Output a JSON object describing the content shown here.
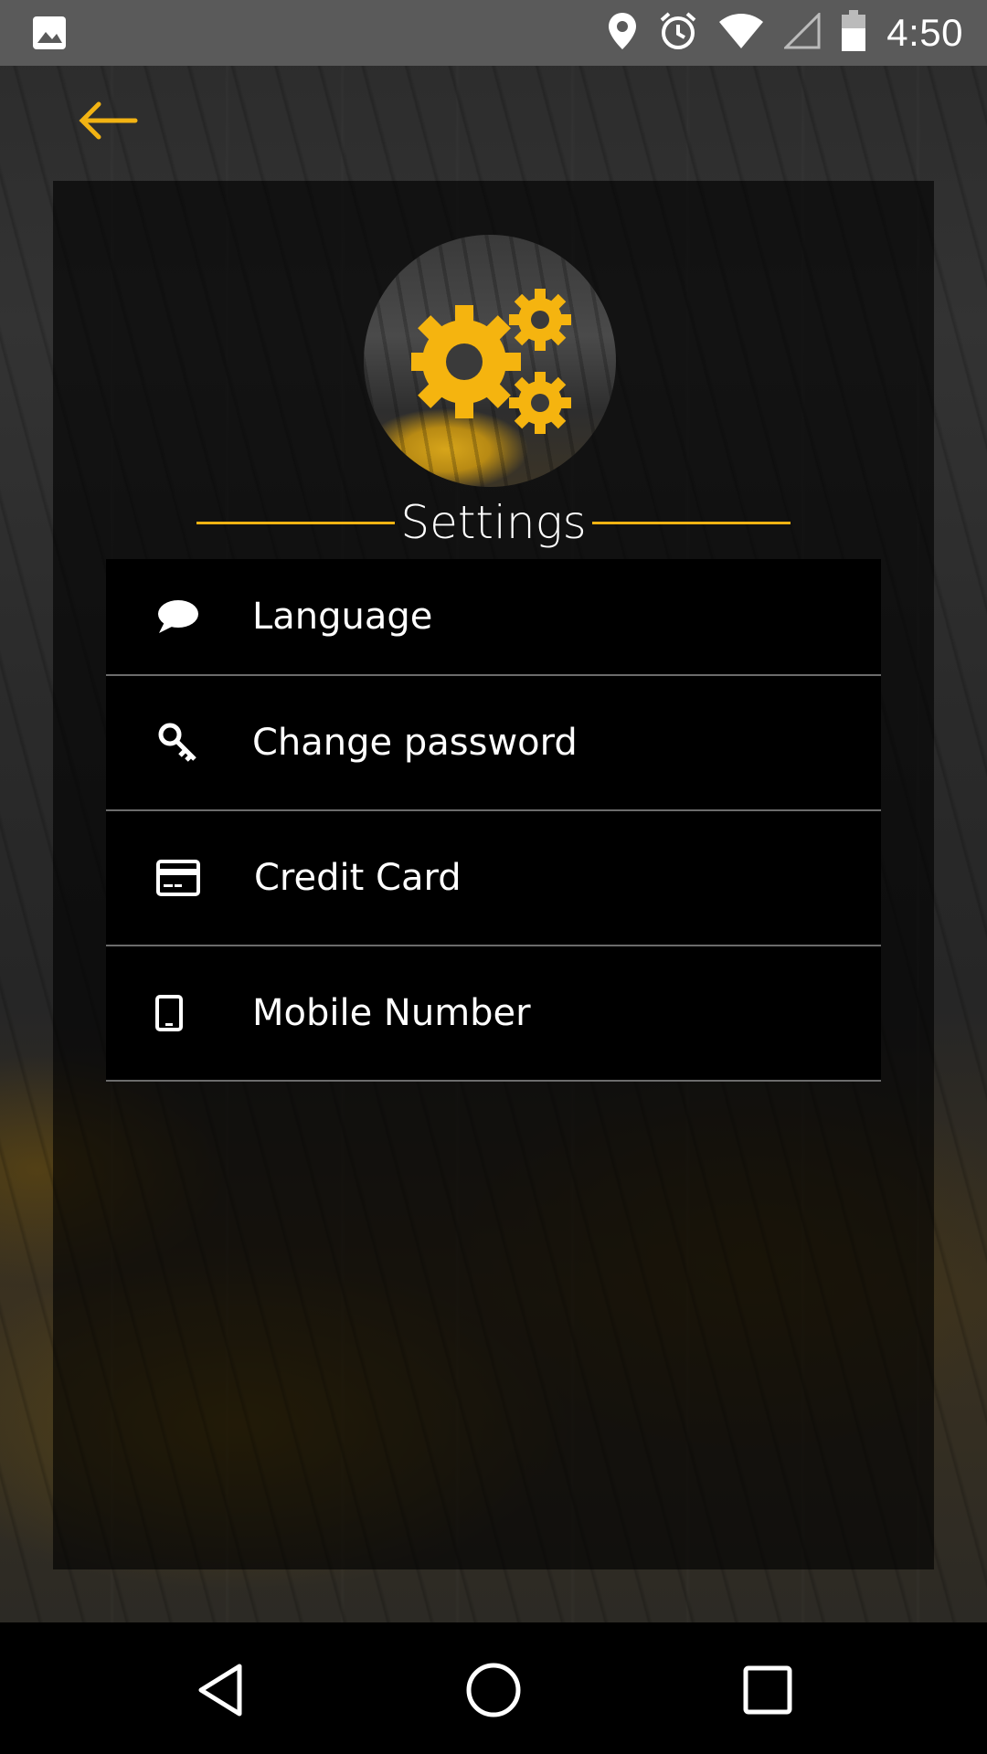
{
  "status_bar": {
    "time": "4:50",
    "icons": [
      "image-icon",
      "location-icon",
      "alarm-icon",
      "wifi-icon",
      "signal-icon",
      "battery-icon"
    ]
  },
  "header": {
    "back_icon": "arrow-left-icon"
  },
  "settings": {
    "title": "Settings",
    "items": [
      {
        "label": "Language",
        "icon": "chat-bubble-icon"
      },
      {
        "label": "Change password",
        "icon": "key-icon"
      },
      {
        "label": "Credit Card",
        "icon": "credit-card-icon"
      },
      {
        "label": "Mobile Number",
        "icon": "phone-icon"
      }
    ]
  },
  "nav_bar": {
    "buttons": [
      "back-triangle-icon",
      "home-circle-icon",
      "recents-square-icon"
    ]
  },
  "colors": {
    "accent": "#f2b313",
    "panel": "#000000",
    "divider": "#6c6c6c",
    "text": "#ffffff"
  }
}
